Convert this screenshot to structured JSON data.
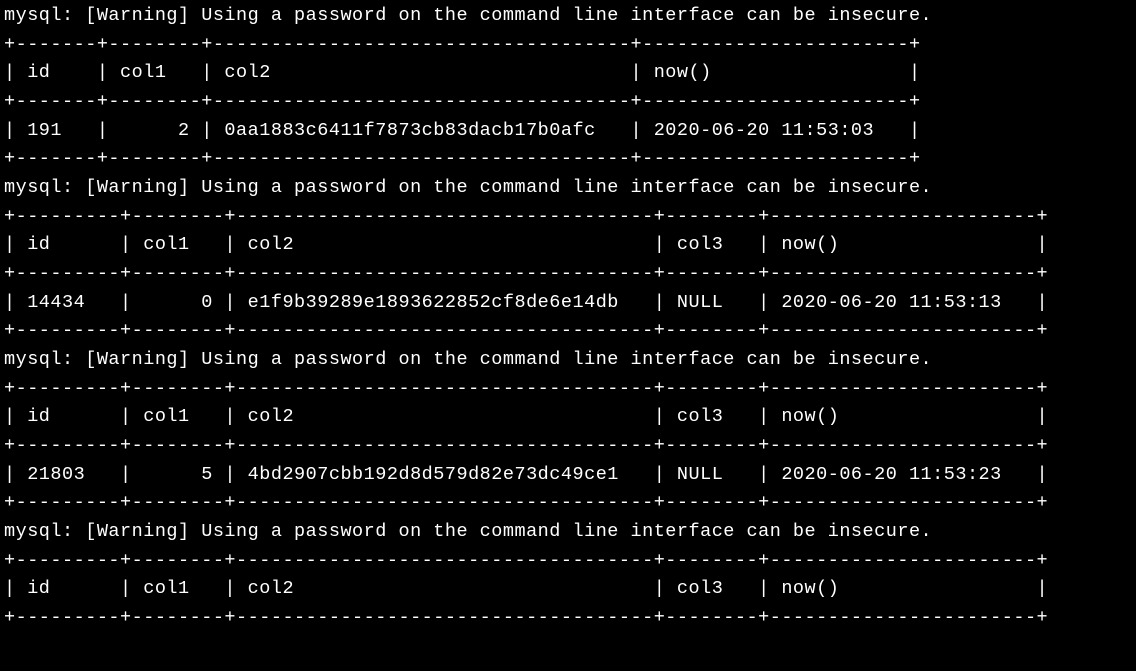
{
  "warning": "mysql: [Warning] Using a password on the command line interface can be insecure.",
  "blocks": [
    {
      "widths": [
        5,
        6,
        34,
        21
      ],
      "headers": [
        "id",
        "col1",
        "col2",
        "now()"
      ],
      "aligns": [
        "l",
        "r",
        "l",
        "l"
      ],
      "row": [
        "191",
        "2",
        "0aa1883c6411f7873cb83dacb17b0afc",
        "2020-06-20 11:53:03"
      ]
    },
    {
      "widths": [
        7,
        6,
        34,
        6,
        21
      ],
      "headers": [
        "id",
        "col1",
        "col2",
        "col3",
        "now()"
      ],
      "aligns": [
        "l",
        "r",
        "l",
        "l",
        "l"
      ],
      "row": [
        "14434",
        "0",
        "e1f9b39289e1893622852cf8de6e14db",
        "NULL",
        "2020-06-20 11:53:13"
      ]
    },
    {
      "widths": [
        7,
        6,
        34,
        6,
        21
      ],
      "headers": [
        "id",
        "col1",
        "col2",
        "col3",
        "now()"
      ],
      "aligns": [
        "l",
        "r",
        "l",
        "l",
        "l"
      ],
      "row": [
        "21803",
        "5",
        "4bd2907cbb192d8d579d82e73dc49ce1",
        "NULL",
        "2020-06-20 11:53:23"
      ]
    },
    {
      "widths": [
        7,
        6,
        34,
        6,
        21
      ],
      "headers": [
        "id",
        "col1",
        "col2",
        "col3",
        "now()"
      ],
      "aligns": [
        "l",
        "r",
        "l",
        "l",
        "l"
      ],
      "row": null
    }
  ]
}
